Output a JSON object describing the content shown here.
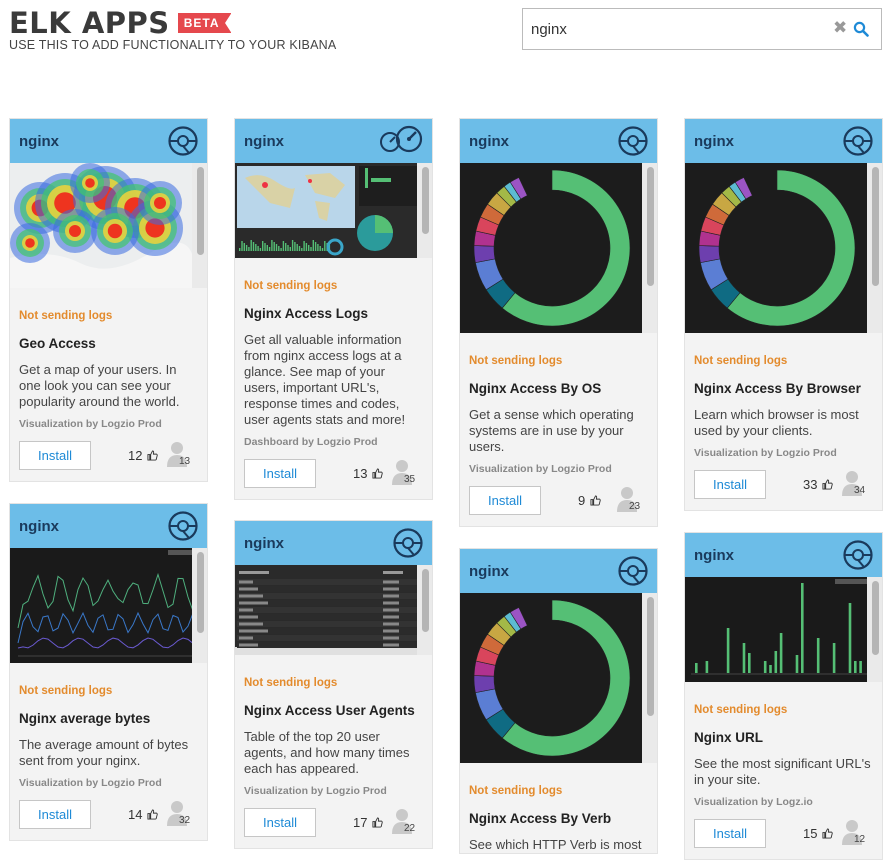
{
  "header": {
    "title": "ELK APPS",
    "beta": "BETA",
    "subtitle": "USE THIS TO ADD FUNCTIONALITY TO YOUR KIBANA"
  },
  "search": {
    "value": "nginx",
    "clear_icon": "close-icon",
    "search_icon": "search-icon"
  },
  "colors": {
    "header_blue": "#6cbde8",
    "status_orange": "#e38b2d",
    "install_blue": "#1e8ad6",
    "beta_red": "#e5484d"
  },
  "cards": [
    {
      "tag": "nginx",
      "status": "Not sending logs",
      "title": "Geo Access",
      "desc": "Get a map of your users. In one look you can see your popularity around the world.",
      "by": "Visualization by Logzio Prod",
      "install": "Install",
      "likes": "12",
      "users": "13",
      "thumb": "heatmap"
    },
    {
      "tag": "nginx",
      "status": "Not sending logs",
      "title": "Nginx Access Logs",
      "desc": "Get all valuable information from nginx access logs at a glance. See map of your users, important URL's, response times and codes, user agents stats and more!",
      "by": "Dashboard by Logzio Prod",
      "install": "Install",
      "likes": "13",
      "users": "35",
      "thumb": "dashboard"
    },
    {
      "tag": "nginx",
      "status": "Not sending logs",
      "title": "Nginx Access By OS",
      "desc": "Get a sense which operating systems are in use by your users.",
      "by": "Visualization by Logzio Prod",
      "install": "Install",
      "likes": "9",
      "users": "23",
      "thumb": "donut"
    },
    {
      "tag": "nginx",
      "status": "Not sending logs",
      "title": "Nginx Access By Browser",
      "desc": "Learn which browser is most used by your clients.",
      "by": "Visualization by Logzio Prod",
      "install": "Install",
      "likes": "33",
      "users": "34",
      "thumb": "donut"
    },
    {
      "tag": "nginx",
      "status": "Not sending logs",
      "title": "Nginx average bytes",
      "desc": "The average amount of bytes sent from your nginx.",
      "by": "Visualization by Logzio Prod",
      "install": "Install",
      "likes": "14",
      "users": "32",
      "thumb": "lines"
    },
    {
      "tag": "nginx",
      "status": "Not sending logs",
      "title": "Nginx Access User Agents",
      "desc": "Table of the top 20 user agents, and how many times each has appeared.",
      "by": "Visualization by Logzio Prod",
      "install": "Install",
      "likes": "17",
      "users": "22",
      "thumb": "table"
    },
    {
      "tag": "nginx",
      "status": "Not sending logs",
      "title": "Nginx Access By Verb",
      "desc": "See which HTTP Verb is most",
      "by": "",
      "install": "",
      "likes": "",
      "users": "",
      "thumb": "donut"
    },
    {
      "tag": "nginx",
      "status": "Not sending logs",
      "title": "Nginx URL",
      "desc": "See the most significant URL's in your site.",
      "by": "Visualization by Logz.io",
      "install": "Install",
      "likes": "15",
      "users": "12",
      "thumb": "bars"
    }
  ]
}
